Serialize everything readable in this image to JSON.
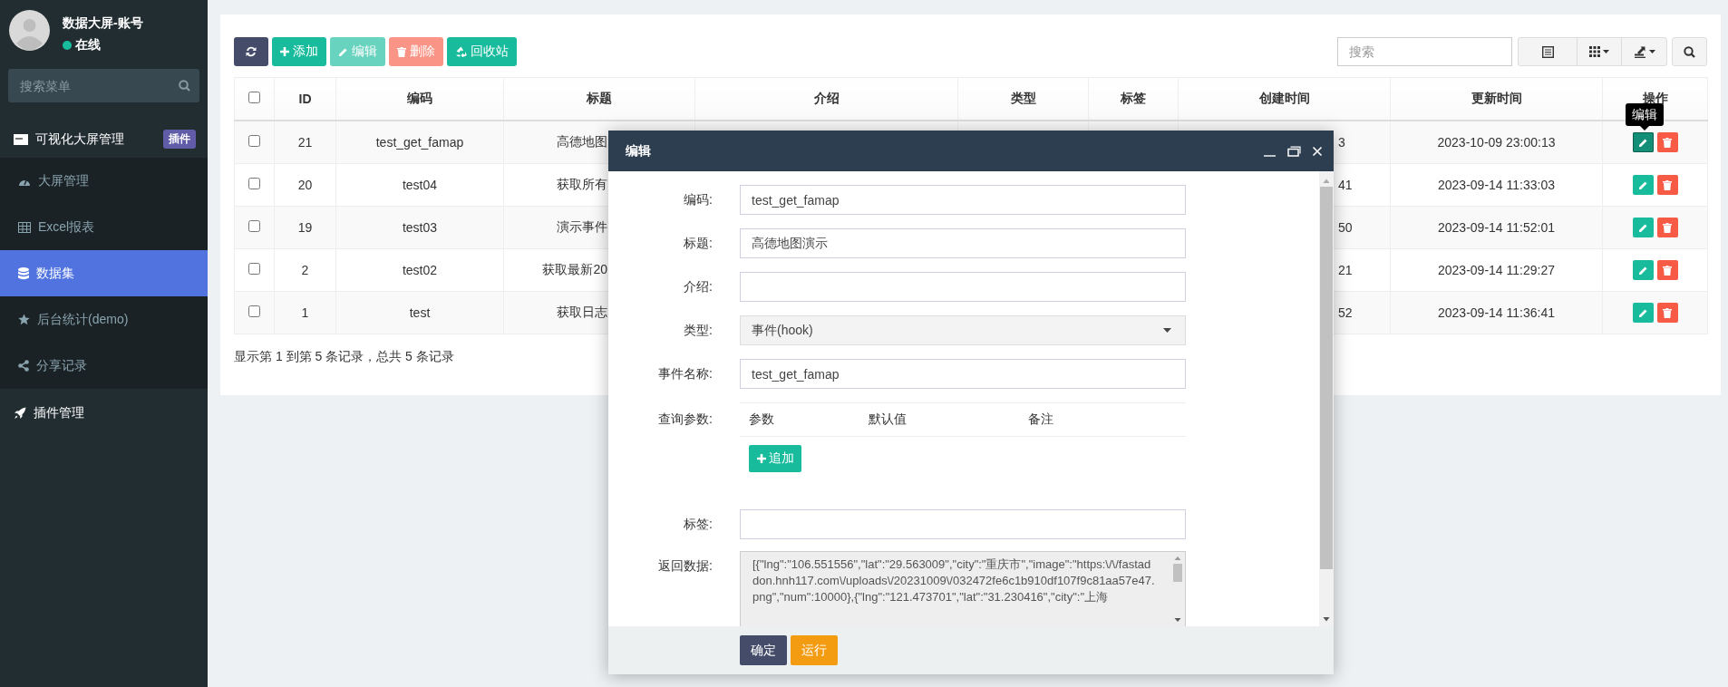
{
  "sidebar": {
    "user": {
      "name": "数据大屏-账号",
      "status": "在线"
    },
    "search": {
      "placeholder": "搜索菜单"
    },
    "menu": [
      {
        "label": "可视化大屏管理",
        "badge": "插件",
        "selected": false,
        "expanded": true,
        "children": [
          {
            "label": "大屏管理",
            "selected": false
          },
          {
            "label": "Excel报表",
            "selected": false
          },
          {
            "label": "数据集",
            "selected": true
          },
          {
            "label": "后台统计(demo)",
            "selected": false
          },
          {
            "label": "分享记录",
            "selected": false
          }
        ]
      },
      {
        "label": "插件管理",
        "selected": false
      }
    ]
  },
  "toolbar": {
    "buttons": [
      {
        "kind": "refresh",
        "disabled": false
      },
      {
        "kind": "add",
        "label": "添加",
        "disabled": false
      },
      {
        "kind": "edit",
        "label": "编辑",
        "disabled": true
      },
      {
        "kind": "delete",
        "label": "删除",
        "disabled": true
      },
      {
        "kind": "recycle",
        "label": "回收站",
        "disabled": false
      }
    ],
    "search": {
      "placeholder": "搜索"
    }
  },
  "table": {
    "header_checked": false,
    "columns": [
      "ID",
      "编码",
      "标题",
      "介绍",
      "类型",
      "标签",
      "创建时间",
      "更新时间",
      "操作"
    ],
    "rows": [
      {
        "checked": false,
        "id": "21",
        "code": "test_get_famap",
        "title": "高德地图",
        "created": "3",
        "updated": "2023-10-09 23:00:13",
        "hovered": true,
        "tooltip": "编辑"
      },
      {
        "checked": false,
        "id": "20",
        "code": "test04",
        "title": "获取所有",
        "created": "41",
        "updated": "2023-09-14 11:33:03",
        "hovered": false
      },
      {
        "checked": false,
        "id": "19",
        "code": "test03",
        "title": "演示事件",
        "created": "50",
        "updated": "2023-09-14 11:52:01",
        "hovered": false
      },
      {
        "checked": false,
        "id": "2",
        "code": "test02",
        "title": "获取最新20",
        "created": "21",
        "updated": "2023-09-14 11:29:27",
        "hovered": false
      },
      {
        "checked": false,
        "id": "1",
        "code": "test",
        "title": "获取日志",
        "created": "52",
        "updated": "2023-09-14 11:36:41",
        "hovered": false
      }
    ],
    "summary": "显示第 1 到第 5 条记录，总共 5 条记录"
  },
  "dialog": {
    "title": "编辑",
    "fields": [
      {
        "kind": "text",
        "label": "编码:",
        "value": "test_get_famap"
      },
      {
        "kind": "text",
        "label": "标题:",
        "value": "高德地图演示"
      },
      {
        "kind": "text",
        "label": "介绍:"
      },
      {
        "kind": "select",
        "label": "类型:",
        "value": "事件(hook)"
      },
      {
        "kind": "text",
        "label": "事件名称:",
        "value": "test_get_famap"
      },
      {
        "kind": "params",
        "label": "查询参数:",
        "columns": [
          "参数",
          "默认值",
          "备注"
        ],
        "button": "追加"
      },
      {
        "kind": "text",
        "label": "标签:"
      },
      {
        "kind": "textarea",
        "label": "返回数据:",
        "value": "[{\"lng\":\"106.551556\",\"lat\":\"29.563009\",\"city\":\"重庆市\",\"image\":\"https:\\/\\/fastaddon.hnh117.com\\/uploads\\/20231009\\/032472fe6c1b910df107f9c81aa57e47.png\",\"num\":10000},{\"lng\":\"121.473701\",\"lat\":\"31.230416\",\"city\":\"上海"
      }
    ],
    "buttons": [
      {
        "kind": "primary",
        "label": "确定"
      },
      {
        "kind": "warning",
        "label": "运行"
      }
    ]
  }
}
